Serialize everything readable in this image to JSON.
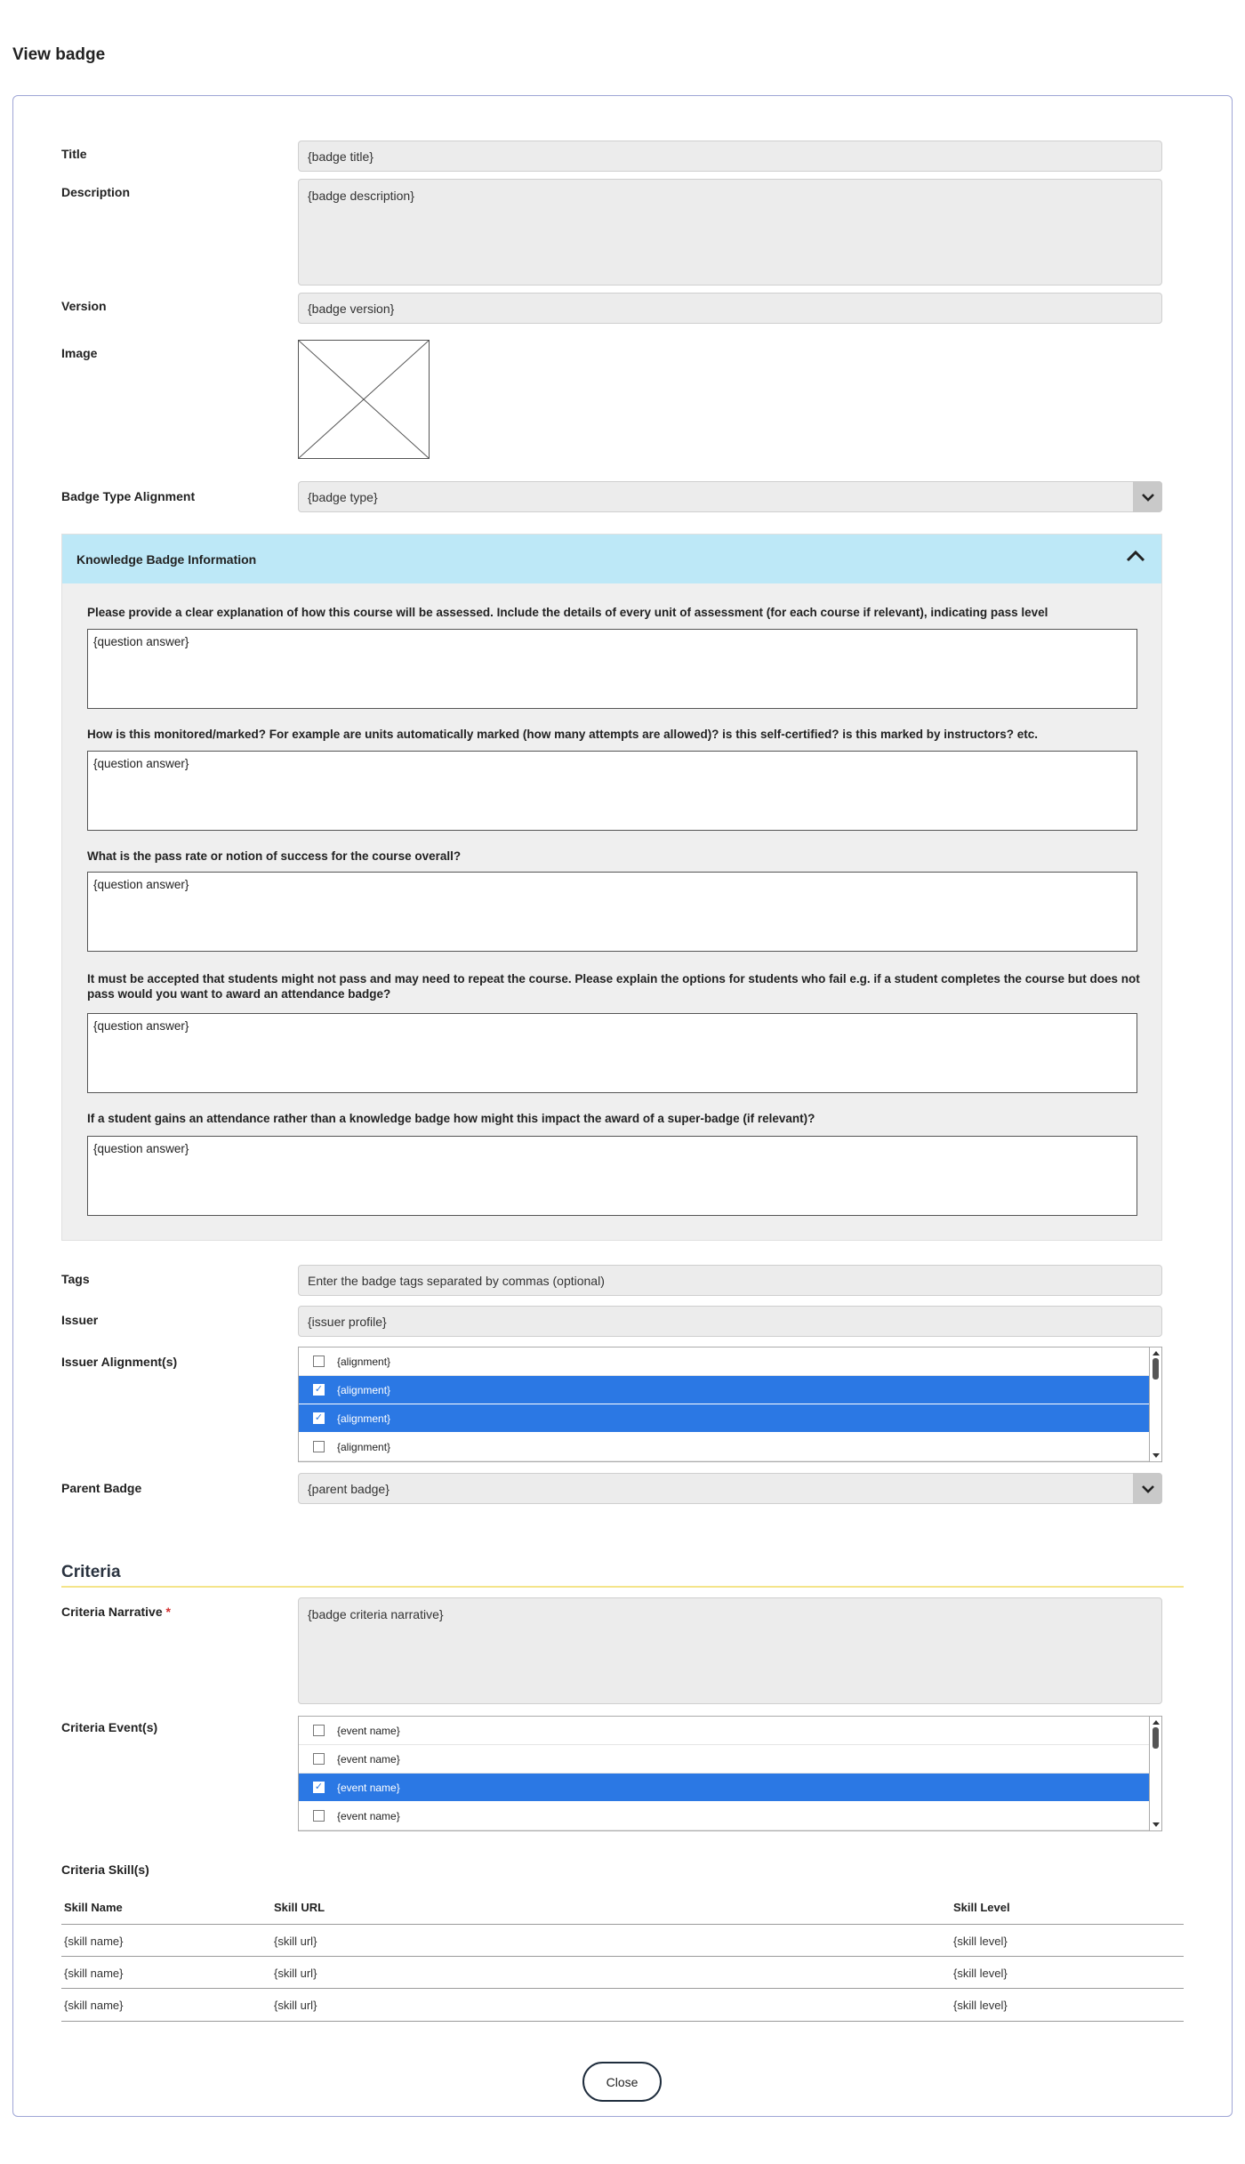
{
  "page_title": "View badge",
  "form": {
    "title": {
      "label": "Title",
      "value": "{badge title}"
    },
    "description": {
      "label": "Description",
      "value": "{badge description}"
    },
    "version": {
      "label": "Version",
      "value": "{badge version}"
    },
    "image": {
      "label": "Image"
    },
    "badge_type": {
      "label": "Badge Type Alignment",
      "value": "{badge type}"
    },
    "tags": {
      "label": "Tags",
      "placeholder": "Enter the badge tags separated by commas (optional)"
    },
    "issuer": {
      "label": "Issuer",
      "value": "{issuer profile}"
    },
    "issuer_alignments": {
      "label": "Issuer Alignment(s)",
      "items": [
        {
          "label": "{alignment}",
          "checked": false
        },
        {
          "label": "{alignment}",
          "checked": true
        },
        {
          "label": "{alignment}",
          "checked": true
        },
        {
          "label": "{alignment}",
          "checked": false
        }
      ]
    },
    "parent_badge": {
      "label": "Parent Badge",
      "value": "{parent badge}"
    }
  },
  "knowledge_panel": {
    "title": "Knowledge Badge Information",
    "toggle_icon": "chevron-up-icon",
    "questions": [
      {
        "question": "Please provide a clear explanation of how this course will be assessed. Include the details of every unit of assessment (for each course if relevant), indicating pass level",
        "answer": "{question answer}"
      },
      {
        "question": "How is this monitored/marked? For example are units automatically marked (how many attempts are allowed)? is this self-certified? is this marked by instructors? etc.",
        "answer": "{question answer}"
      },
      {
        "question": "What is the pass rate or notion of success for the course overall?",
        "answer": "{question answer}"
      },
      {
        "question": "It must be accepted that students might not pass and may need to repeat the course. Please explain the options for students who fail e.g. if a student completes the course but does not pass would you want to award an attendance badge?",
        "answer": "{question answer}"
      },
      {
        "question": "If a student gains an attendance rather than a knowledge badge how might this impact the award of a super-badge (if relevant)?",
        "answer": "{question answer}"
      }
    ]
  },
  "criteria": {
    "section_title": "Criteria",
    "narrative": {
      "label": "Criteria Narrative",
      "required_marker": "*",
      "value": "{badge criteria narrative}"
    },
    "events": {
      "label": "Criteria Event(s)",
      "items": [
        {
          "label": "{event name}",
          "checked": false
        },
        {
          "label": "{event name}",
          "checked": false
        },
        {
          "label": "{event name}",
          "checked": true
        },
        {
          "label": "{event name}",
          "checked": false
        }
      ]
    },
    "skills": {
      "label": "Criteria Skill(s)",
      "columns": [
        "Skill Name",
        "Skill URL",
        "Skill Level"
      ],
      "rows": [
        [
          "{skill name}",
          "{skill url}",
          "{skill level}"
        ],
        [
          "{skill name}",
          "{skill url}",
          "{skill level}"
        ],
        [
          "{skill name}",
          "{skill url}",
          "{skill level}"
        ]
      ]
    }
  },
  "actions": {
    "close_label": "Close"
  },
  "colors": {
    "selected_row": "#2b78e4",
    "panel_header": "#bde8f7",
    "section_rule": "#f4e48a"
  }
}
